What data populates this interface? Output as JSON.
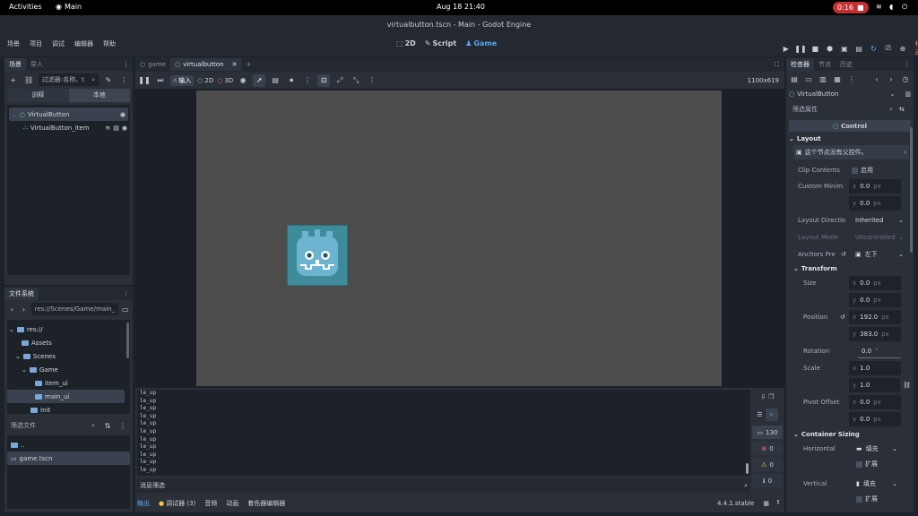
{
  "os": {
    "activities": "Activities",
    "app": "Main",
    "datetime": "Aug 18  21:40",
    "record": "0:16"
  },
  "window": {
    "title": "virtualbutton.tscn - Main - Godot Engine"
  },
  "menu": {
    "items": [
      "场景",
      "项目",
      "调试",
      "编辑器",
      "帮助"
    ]
  },
  "workspaces": {
    "d2": "2D",
    "script": "Script",
    "game": "Game"
  },
  "run": {
    "mode": "移动"
  },
  "scene_dock": {
    "tabs": [
      "场景",
      "导入"
    ],
    "filter_placeholder": "过滤器:名称、t",
    "subtabs": [
      "训释",
      "本地"
    ],
    "nodes": [
      {
        "name": "VirtualButton"
      },
      {
        "name": "VirtualButton_item"
      }
    ]
  },
  "fs_dock": {
    "title": "文件系统",
    "path": "res://Scenes/Game/main_",
    "tree": [
      {
        "name": "res://"
      },
      {
        "name": "Assets"
      },
      {
        "name": "Scenes"
      },
      {
        "name": "Game"
      },
      {
        "name": "item_ui"
      },
      {
        "name": "main_ui"
      },
      {
        "name": "Init"
      }
    ],
    "filter_label": "筛选文件",
    "files": [
      "..",
      "game.tscn"
    ]
  },
  "editor": {
    "tabs": [
      "game",
      "virtualbutton"
    ],
    "toolbar": {
      "input": "输入",
      "d2": "2D",
      "d3": "3D"
    },
    "resolution": "1100x619"
  },
  "output": {
    "lines": [
      "le_up",
      "le_up",
      "le_up",
      "le_up",
      "le_up",
      "le_up",
      "le_up",
      "le_up",
      "le_up",
      "le_up",
      "le_up",
      "le_up"
    ],
    "filter_placeholder": "消息筛选",
    "counts": {
      "messages": "130",
      "errors": "0",
      "warnings": "0",
      "info": "0"
    },
    "bottom_tabs": [
      "输出",
      "调试器 (3)",
      "音频",
      "动画",
      "着色器编辑器"
    ],
    "version": "4.4.1.stable"
  },
  "inspector": {
    "tabs": [
      "检查器",
      "节点",
      "历史"
    ],
    "node": "VirtualButton",
    "filter_placeholder": "筛选属性",
    "class": "Control",
    "layout": "Layout",
    "warning": "这个节点没有父控件。",
    "clip_label": "Clip Contents",
    "clip_value": "启用",
    "min_label": "Custom Minim",
    "min_x": "0.0",
    "min_y": "0.0",
    "dir_label": "Layout Directio",
    "dir_value": "Inherited",
    "mode_label": "Layout Mode",
    "mode_value": "Uncontrolled",
    "anchor_label": "Anchors Pre",
    "anchor_value": "左下",
    "transform": "Transform",
    "size_label": "Size",
    "size_x": "0.0",
    "size_y": "0.0",
    "pos_label": "Position",
    "pos_x": "192.0",
    "pos_y": "383.0",
    "rot_label": "Rotation",
    "rot_value": "0.0",
    "scale_label": "Scale",
    "scale_x": "1.0",
    "scale_y": "1.0",
    "pivot_label": "Pivot Offset",
    "pivot_x": "0.0",
    "pivot_y": "0.0",
    "container": "Container Sizing",
    "h_label": "Horizontal",
    "h_value": "填充",
    "h_expand": "扩展",
    "v_label": "Vertical",
    "v_value": "填充",
    "v_expand": "扩展",
    "unit_px": "px",
    "unit_deg": "°"
  }
}
